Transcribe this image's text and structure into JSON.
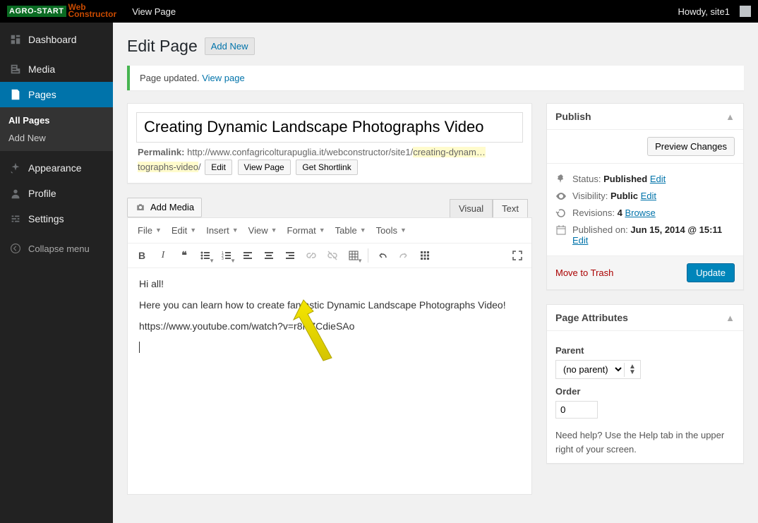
{
  "adminbar": {
    "logo_left": "AGRO-START",
    "logo_right_top": "Web",
    "logo_right_bottom": "Constructor",
    "view_page": "View Page",
    "howdy": "Howdy, site1"
  },
  "sidebar": {
    "dashboard": "Dashboard",
    "media": "Media",
    "pages": "Pages",
    "pages_sub_all": "All Pages",
    "pages_sub_add": "Add New",
    "appearance": "Appearance",
    "profile": "Profile",
    "settings": "Settings",
    "collapse": "Collapse menu"
  },
  "header": {
    "title": "Edit Page",
    "add_new": "Add New"
  },
  "notice": {
    "text": "Page updated. ",
    "link": "View page"
  },
  "editor": {
    "title_value": "Creating Dynamic Landscape Photographs Video",
    "permalink_label": "Permalink:",
    "permalink_base": "http://www.confagricolturapuglia.it/webconstructor/site1/",
    "permalink_slug1": "creating-dynam…",
    "permalink_slug2": "tographs-video",
    "btn_edit": "Edit",
    "btn_view_page": "View Page",
    "btn_shortlink": "Get Shortlink",
    "add_media": "Add Media",
    "tab_visual": "Visual",
    "tab_text": "Text",
    "menu_file": "File",
    "menu_edit": "Edit",
    "menu_insert": "Insert",
    "menu_view": "View",
    "menu_format": "Format",
    "menu_table": "Table",
    "menu_tools": "Tools",
    "body_p1": "Hi all!",
    "body_p2": "Here you can learn how to create fantastic Dynamic Landscape Photographs Video!",
    "body_p3": "https://www.youtube.com/watch?v=r8HZCdieSAo"
  },
  "publish": {
    "title": "Publish",
    "preview_btn": "Preview Changes",
    "status_lbl": "Status: ",
    "status_val": "Published",
    "edit": "Edit",
    "visibility_lbl": "Visibility: ",
    "visibility_val": "Public",
    "revisions_lbl": "Revisions: ",
    "revisions_val": "4",
    "browse": "Browse",
    "published_lbl": "Published on: ",
    "published_val": "Jun 15, 2014 @ 15:11",
    "trash": "Move to Trash",
    "update": "Update"
  },
  "attributes": {
    "title": "Page Attributes",
    "parent_lbl": "Parent",
    "parent_val": "(no parent)",
    "order_lbl": "Order",
    "order_val": "0",
    "help": "Need help? Use the Help tab in the upper right of your screen."
  }
}
